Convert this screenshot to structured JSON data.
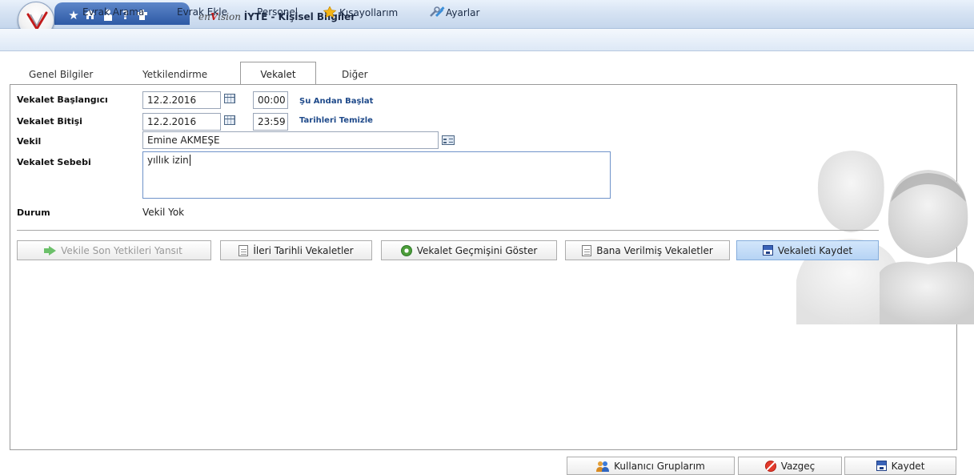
{
  "window": {
    "brand_prefix": "en",
    "brand_v": "V",
    "brand_suffix": "ision",
    "title": "İYTE - Kişisel Bilgiler"
  },
  "quick_access_icons": [
    "star-icon",
    "home-icon",
    "user-icon",
    "help-icon",
    "plugin-icon"
  ],
  "menu": {
    "items": [
      {
        "label": "Evrak Arama",
        "icon": ""
      },
      {
        "label": "Evrak Ekle",
        "icon": ""
      },
      {
        "label": "Personel",
        "icon": ""
      },
      {
        "label": "Kısayollarım",
        "icon": "star-icon"
      },
      {
        "label": "Ayarlar",
        "icon": "tools-icon"
      }
    ]
  },
  "tabs": [
    {
      "label": "Genel Bilgiler",
      "active": false
    },
    {
      "label": "Yetkilendirme",
      "active": false
    },
    {
      "label": "Vekalet",
      "active": true
    },
    {
      "label": "Diğer",
      "active": false
    }
  ],
  "form": {
    "start_label": "Vekalet Başlangıcı",
    "start_date": "12.2.2016",
    "start_time": "00:00",
    "start_link": "Şu Andan Başlat",
    "end_label": "Vekalet Bitişi",
    "end_date": "12.2.2016",
    "end_time": "23:59",
    "end_link": "Tarihleri Temizle",
    "proxy_label": "Vekil",
    "proxy_value": "Emine AKMEŞE",
    "reason_label": "Vekalet Sebebi",
    "reason_value": "yıllık izin",
    "status_label": "Durum",
    "status_value": "Vekil Yok"
  },
  "actions": {
    "reflect": "Vekile Son Yetkileri Yansıt",
    "future": "İleri Tarihli Vekaletler",
    "history": "Vekalet Geçmişini Göster",
    "given": "Bana Verilmiş Vekaletler",
    "save_proxy": "Vekaleti Kaydet"
  },
  "footer": {
    "groups": "Kullanıcı Gruplarım",
    "cancel": "Vazgeç",
    "save": "Kaydet"
  },
  "colors": {
    "accent": "#2e5aa5",
    "primary_button": "#b6d3f4",
    "link": "#1f4a8a",
    "cancel": "#e23a2c"
  }
}
